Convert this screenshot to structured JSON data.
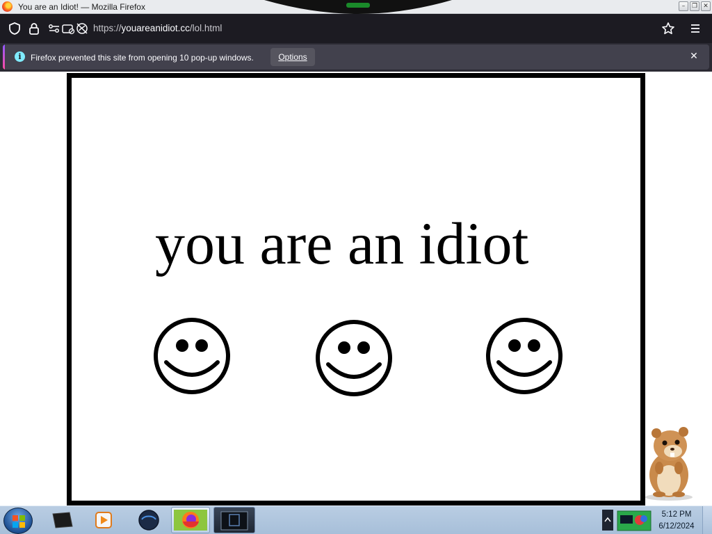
{
  "window": {
    "title": "You are an Idiot! — Mozilla Firefox",
    "controls": {
      "minimize": "–",
      "maximize": "❐",
      "close": "✕"
    }
  },
  "navbar": {
    "url_prefix": "https://",
    "url_host": "youareanidiot.cc",
    "url_path": "/lol.html",
    "icons": [
      "shield-icon",
      "lock-icon",
      "permissions-icon",
      "camera-blocked-icon",
      "tracking-icon",
      "bookmark-star-icon",
      "menu-icon"
    ]
  },
  "notification": {
    "message": "Firefox prevented this site from opening 10 pop-up windows.",
    "options_label": "Options",
    "info_glyph": "i",
    "close_glyph": "✕"
  },
  "page": {
    "headline": "you are an idiot",
    "smiley_count": 3,
    "frame_color": "#000000"
  },
  "taskbar": {
    "items": [
      "start-orb",
      "cmd-icon",
      "media-player-icon",
      "vpn-globe-icon",
      "firefox-taskbar-button",
      "app-window-button"
    ],
    "clock_time": "5:12 PM",
    "clock_date": "6/12/2024"
  },
  "colors": {
    "toolbar_bg": "#1c1b22",
    "notif_bg": "#42414d",
    "accent": "#9059ff",
    "info_blue": "#80ebff",
    "taskbar": "#b9cde3"
  }
}
